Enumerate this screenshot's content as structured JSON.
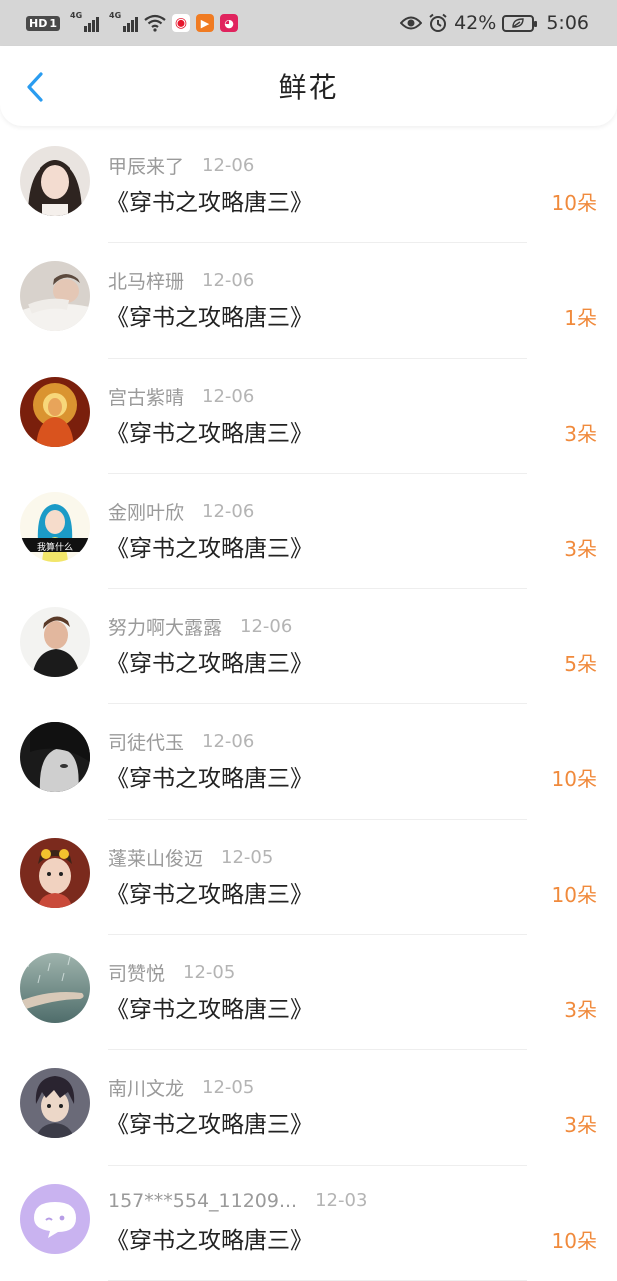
{
  "status_bar": {
    "hd_label": "HD",
    "sim_label": "1",
    "net1": "4G",
    "net2": "4G",
    "battery_percent": "42%",
    "time": "5:06",
    "icons": [
      "wifi-icon",
      "weibo-icon",
      "video-app-icon",
      "store-app-icon",
      "eye-icon",
      "alarm-icon",
      "battery-icon"
    ]
  },
  "header": {
    "title": "鲜花",
    "back_icon": "chevron-left-icon",
    "accent_color": "#2a9cf0"
  },
  "colors": {
    "count": "#f08a3c",
    "name": "#9a9a9a",
    "date": "#b4b4b4"
  },
  "items": [
    {
      "name": "甲辰来了",
      "date": "12-06",
      "book": "《穿书之攻略唐三》",
      "count": "10朵",
      "avatar": "avatar-girl"
    },
    {
      "name": "北马梓珊",
      "date": "12-06",
      "book": "《穿书之攻略唐三》",
      "count": "1朵",
      "avatar": "avatar-boy-lying"
    },
    {
      "name": "宫古紫晴",
      "date": "12-06",
      "book": "《穿书之攻略唐三》",
      "count": "3朵",
      "avatar": "avatar-buddha"
    },
    {
      "name": "金刚叶欣",
      "date": "12-06",
      "book": "《穿书之攻略唐三》",
      "count": "3朵",
      "avatar": "avatar-cartoon-girl",
      "avatar_caption": "我算什么"
    },
    {
      "name": "努力啊大露露",
      "date": "12-06",
      "book": "《穿书之攻略唐三》",
      "count": "5朵",
      "avatar": "avatar-man"
    },
    {
      "name": "司徒代玉",
      "date": "12-06",
      "book": "《穿书之攻略唐三》",
      "count": "10朵",
      "avatar": "avatar-bw-face"
    },
    {
      "name": "蓬莱山俊迈",
      "date": "12-05",
      "book": "《穿书之攻略唐三》",
      "count": "10朵",
      "avatar": "avatar-baby"
    },
    {
      "name": "司赞悦",
      "date": "12-05",
      "book": "《穿书之攻略唐三》",
      "count": "3朵",
      "avatar": "avatar-hand-rain"
    },
    {
      "name": "南川文龙",
      "date": "12-05",
      "book": "《穿书之攻略唐三》",
      "count": "3朵",
      "avatar": "avatar-anime-boy"
    },
    {
      "name": "157***554_11209...",
      "date": "12-03",
      "book": "《穿书之攻略唐三》",
      "count": "10朵",
      "avatar": "avatar-default-chat"
    }
  ]
}
